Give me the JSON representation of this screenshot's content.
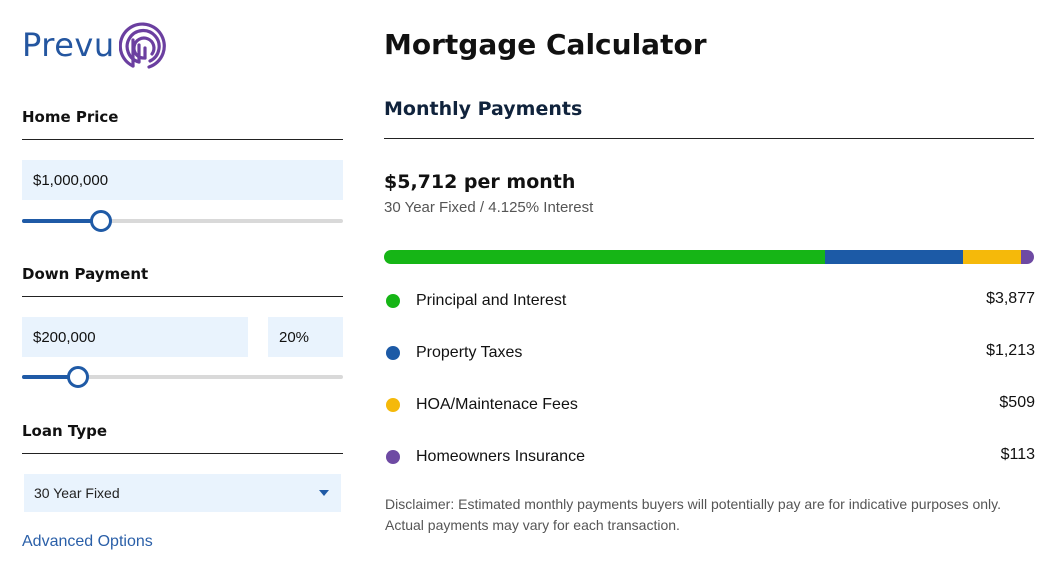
{
  "brand": {
    "name": "Prevu",
    "color": "#2456a0",
    "mark_color": "#6b3fa0"
  },
  "sidebar": {
    "home_price": {
      "label": "Home Price",
      "value": "$1,000,000",
      "slider_fraction": 0.245
    },
    "down_payment": {
      "label": "Down Payment",
      "value": "$200,000",
      "percent": "20%",
      "slider_fraction": 0.175
    },
    "loan_type": {
      "label": "Loan Type",
      "selected": "30 Year Fixed"
    },
    "advanced_link": "Advanced Options"
  },
  "main": {
    "title": "Mortgage Calculator",
    "section_title": "Monthly Payments",
    "total": "$5,712 per month",
    "summary": "30 Year Fixed / 4.125% Interest",
    "breakdown": [
      {
        "name": "Principal and Interest",
        "amount": "$3,877",
        "value": 3877,
        "color": "#16b516"
      },
      {
        "name": "Property Taxes",
        "amount": "$1,213",
        "value": 1213,
        "color": "#1c5aa6"
      },
      {
        "name": "HOA/Maintenace Fees",
        "amount": "$509",
        "value": 509,
        "color": "#f5b90a"
      },
      {
        "name": "Homeowners Insurance",
        "amount": "$113",
        "value": 113,
        "color": "#6e4aa3"
      }
    ],
    "disclaimer": "Disclaimer: Estimated monthly payments buyers will potentially pay are for indicative purposes only. Actual payments may vary for each transaction."
  },
  "colors": {
    "accent": "#1f5aa6",
    "field_bg": "#e9f3fd",
    "link": "#2a5fa8"
  }
}
